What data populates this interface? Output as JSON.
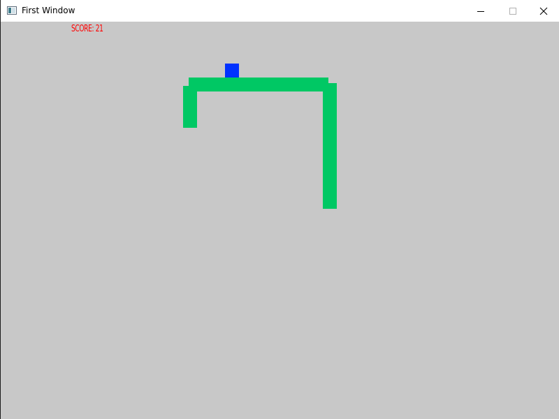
{
  "window": {
    "title": "First Window",
    "minimize_icon": "minimize-icon",
    "maximize_icon": "maximize-icon",
    "close_icon": "close-icon",
    "app_icon": "window-icon"
  },
  "game": {
    "score_label": "SCORE:",
    "score_value": "21",
    "colors": {
      "background": "#c8c8c8",
      "snake": "#00c864",
      "food": "#0032ff",
      "score_text": "#ff0000"
    }
  }
}
